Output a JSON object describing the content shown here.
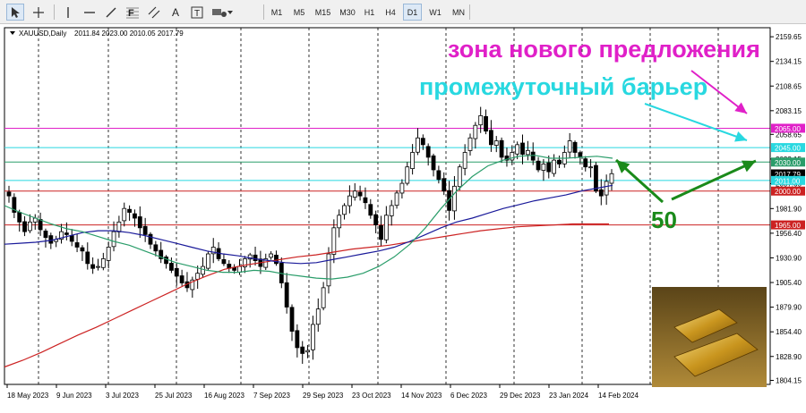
{
  "toolbar": {
    "tools": [
      {
        "name": "cursor-icon"
      },
      {
        "name": "crosshair-icon"
      },
      {
        "name": "vertical-line-icon"
      },
      {
        "name": "horizontal-line-icon"
      },
      {
        "name": "trendline-icon"
      },
      {
        "name": "fibonacci-icon",
        "label": "F"
      },
      {
        "name": "text-icon",
        "label": "A"
      },
      {
        "name": "label-icon",
        "label": "T"
      },
      {
        "name": "shapes-icon"
      }
    ],
    "timeframes": [
      "M1",
      "M5",
      "M15",
      "M30",
      "H1",
      "H4",
      "D1",
      "W1",
      "MN"
    ],
    "active_timeframe": "D1"
  },
  "chart_header": {
    "symbol": "XAUUSD,Daily",
    "ohlc": "2011.84 2023.00 2010.05 2017.79"
  },
  "annotations": {
    "supply_zone": "зона нового предложения",
    "barrier": "промежуточный барьер",
    "ma_label": "50"
  },
  "colors": {
    "supply_zone": "#e020c8",
    "barrier": "#28d8e0",
    "arrows_green": "#1a8a1a",
    "ma50": "#2a9d6a",
    "ma100": "#1a1a9a",
    "ma200": "#cc2222",
    "candles": "#000000"
  },
  "chart_data": {
    "type": "candlestick",
    "symbol": "XAUUSD",
    "timeframe": "Daily",
    "ohlc_last": {
      "open": 2011.84,
      "high": 2023.0,
      "low": 2010.05,
      "close": 2017.79
    },
    "ylim": [
      1800,
      2169
    ],
    "y_ticks": [
      "2159.65",
      "2134.15",
      "2108.65",
      "2083.15",
      "2058.65",
      "2033.15",
      "2007.65",
      "1981.90",
      "1956.40",
      "1930.90",
      "1905.40",
      "1879.90",
      "1854.40",
      "1828.90",
      "1804.15"
    ],
    "x_ticks": [
      "18 May 2023",
      "9 Jun 2023",
      "3 Jul 2023",
      "25 Jul 2023",
      "16 Aug 2023",
      "7 Sep 2023",
      "29 Sep 2023",
      "23 Oct 2023",
      "14 Nov 2023",
      "6 Dec 2023",
      "29 Dec 2023",
      "23 Jan 2024",
      "14 Feb 2024"
    ],
    "levels": [
      {
        "value": 2065.0,
        "label": "2065.00",
        "color": "#e020c8"
      },
      {
        "value": 2045.0,
        "label": "2045.00",
        "color": "#28d8e0"
      },
      {
        "value": 2030.0,
        "label": "2030.00",
        "color": "#2a9d6a"
      },
      {
        "value": 2017.79,
        "label": "2017.79",
        "color": "#000000"
      },
      {
        "value": 2011.0,
        "label": "2011.00",
        "color": "#28d8e0"
      },
      {
        "value": 2000.0,
        "label": "2000.00",
        "color": "#cc2222"
      },
      {
        "value": 1965.0,
        "label": "1965.00",
        "color": "#cc2222"
      }
    ],
    "close_path": [
      1995,
      1978,
      1968,
      1958,
      1968,
      1972,
      1960,
      1952,
      1946,
      1950,
      1958,
      1955,
      1948,
      1942,
      1938,
      1925,
      1920,
      1922,
      1930,
      1942,
      1958,
      1968,
      1982,
      1978,
      1972,
      1962,
      1955,
      1945,
      1938,
      1930,
      1925,
      1918,
      1912,
      1905,
      1900,
      1908,
      1915,
      1922,
      1935,
      1942,
      1930,
      1925,
      1920,
      1918,
      1922,
      1930,
      1934,
      1928,
      1922,
      1930,
      1935,
      1925,
      1905,
      1880,
      1855,
      1838,
      1832,
      1835,
      1862,
      1878,
      1900,
      1935,
      1962,
      1975,
      1985,
      1995,
      2000,
      1995,
      1988,
      1975,
      1965,
      1950,
      1975,
      1985,
      1998,
      2008,
      2025,
      2040,
      2055,
      2048,
      2035,
      2022,
      2012,
      2000,
      1980,
      2005,
      2025,
      2040,
      2055,
      2068,
      2078,
      2062,
      2048,
      2052,
      2035,
      2032,
      2040,
      2048,
      2038,
      2042,
      2032,
      2022,
      2028,
      2020,
      2032,
      2028,
      2040,
      2052,
      2040,
      2035,
      2025,
      2025,
      2000,
      1995,
      2010,
      2018
    ],
    "ma50": [
      1985,
      1978,
      1972,
      1966,
      1961,
      1958,
      1953,
      1948,
      1944,
      1938,
      1932,
      1926,
      1922,
      1918,
      1916,
      1916,
      1918,
      1917,
      1914,
      1912,
      1910,
      1909,
      1911,
      1915,
      1922,
      1932,
      1945,
      1962,
      1982,
      2000,
      2015,
      2026,
      2032,
      2036,
      2037,
      2034,
      2034,
      2035,
      2036,
      2034
    ],
    "ma100": [
      1945,
      1946,
      1947,
      1949,
      1953,
      1957,
      1959,
      1959,
      1957,
      1954,
      1950,
      1946,
      1942,
      1938,
      1935,
      1933,
      1930,
      1928,
      1926,
      1925,
      1926,
      1929,
      1932,
      1935,
      1938,
      1942,
      1948,
      1955,
      1962,
      1968,
      1972,
      1977,
      1982,
      1986,
      1990,
      1993,
      1996,
      2000,
      2003,
      2006
    ],
    "ma200": [
      1818,
      1825,
      1833,
      1842,
      1851,
      1859,
      1868,
      1877,
      1886,
      1895,
      1904,
      1912,
      1919,
      1923,
      1926,
      1929,
      1932,
      1934,
      1937,
      1940,
      1942,
      1944,
      1947,
      1950,
      1953,
      1956,
      1959,
      1961,
      1963,
      1964,
      1965,
      1966,
      1966,
      1966
    ]
  }
}
